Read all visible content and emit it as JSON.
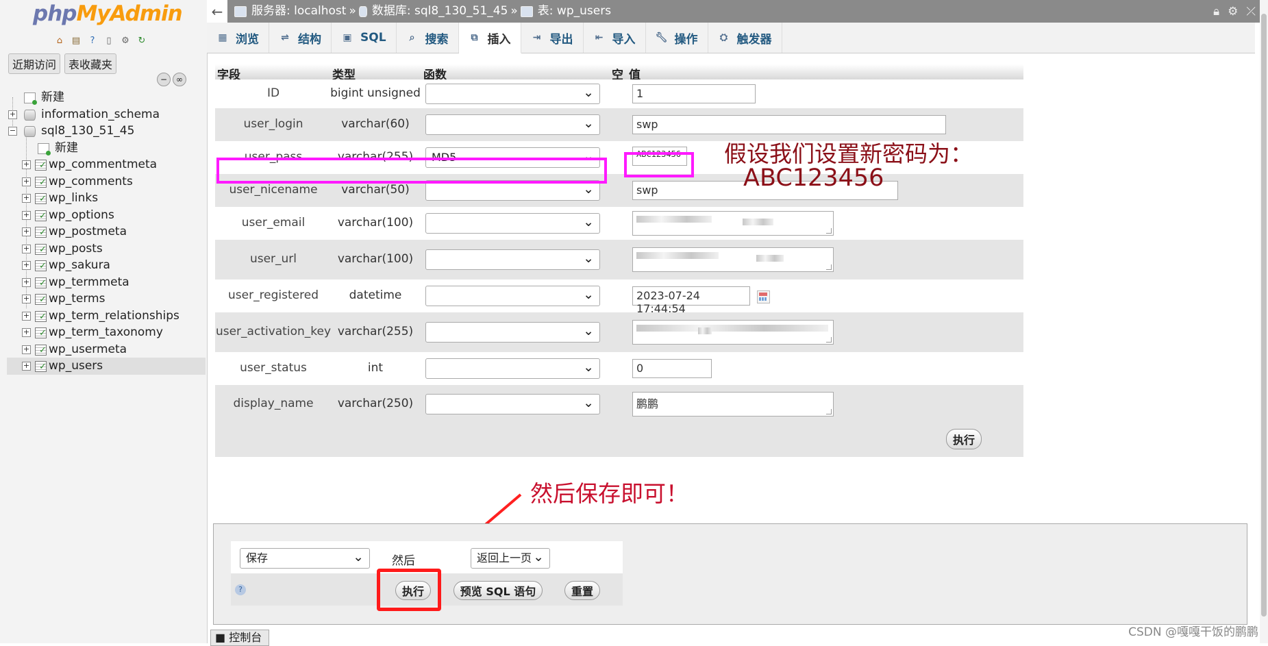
{
  "nav": {
    "logo_php": "php",
    "logo_myadmin": "MyAdmin",
    "tab_recent": "近期访问",
    "tab_favorites": "表收藏夹",
    "tree": {
      "new": "新建",
      "db1": "information_schema",
      "db2": "sql8_130_51_45",
      "db2_new": "新建",
      "tables": [
        "wp_commentmeta",
        "wp_comments",
        "wp_links",
        "wp_options",
        "wp_postmeta",
        "wp_posts",
        "wp_sakura",
        "wp_termmeta",
        "wp_terms",
        "wp_term_relationships",
        "wp_term_taxonomy",
        "wp_usermeta",
        "wp_users"
      ],
      "selected": "wp_users"
    }
  },
  "breadcrumb": {
    "server_label": "服务器: localhost",
    "db_label": "数据库: sql8_130_51_45",
    "table_label": "表: wp_users",
    "sep": "»"
  },
  "tabs": [
    "浏览",
    "结构",
    "SQL",
    "搜索",
    "插入",
    "导出",
    "导入",
    "操作",
    "触发器"
  ],
  "active_tab": "插入",
  "form": {
    "headers": {
      "field": "字段",
      "type": "类型",
      "function": "函数",
      "null": "空",
      "value": "值"
    },
    "rows": [
      {
        "name": "ID",
        "type": "bigint unsigned",
        "func": "",
        "value": "1"
      },
      {
        "name": "user_login",
        "type": "varchar(60)",
        "func": "",
        "value": "swp"
      },
      {
        "name": "user_pass",
        "type": "varchar(255)",
        "func": "MD5",
        "value": "ABC123456"
      },
      {
        "name": "user_nicename",
        "type": "varchar(50)",
        "func": "",
        "value": "swp"
      },
      {
        "name": "user_email",
        "type": "varchar(100)",
        "func": "",
        "value": ""
      },
      {
        "name": "user_url",
        "type": "varchar(100)",
        "func": "",
        "value": ""
      },
      {
        "name": "user_registered",
        "type": "datetime",
        "func": "",
        "value": "2023-07-24 17:44:54"
      },
      {
        "name": "user_activation_key",
        "type": "varchar(255)",
        "func": "",
        "value": ""
      },
      {
        "name": "user_status",
        "type": "int",
        "func": "",
        "value": "0"
      },
      {
        "name": "display_name",
        "type": "varchar(250)",
        "func": "",
        "value": "鹏鹏"
      }
    ],
    "go_button": "执行"
  },
  "annotations": {
    "password_note_line1": "假设我们设置新密码为：",
    "password_note_line2": "ABC123456",
    "save_note": "然后保存即可！",
    "highlight_color": "#ff1aff",
    "note_color": "#c8102e"
  },
  "bottom": {
    "action_select": "保存",
    "then_label": "然后",
    "after_select": "返回上一页",
    "go_button": "执行",
    "preview_button": "预览 SQL 语句",
    "reset_button": "重置"
  },
  "console_tab": "控制台",
  "watermark": "CSDN @嘎嘎干饭的鹏鹏"
}
